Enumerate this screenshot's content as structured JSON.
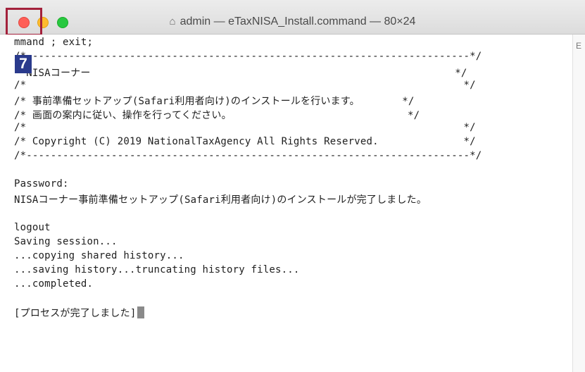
{
  "window": {
    "title": "admin — eTaxNISA_Install.command — 80×24",
    "home_icon": "⌂"
  },
  "step_badge": "7",
  "terminal": {
    "lines": [
      "mmand ; exit;",
      "/*-------------------------------------------------------------------------*/",
      "  NISAコーナー                                                            */",
      "/*                                                                        */",
      "/* 事前準備セットアップ(Safari利用者向け)のインストールを行います。       */",
      "/* 画面の案内に従い、操作を行ってください。                             */",
      "/*                                                                        */",
      "/* Copyright (C) 2019 NationalTaxAgency All Rights Reserved.              */",
      "/*-------------------------------------------------------------------------*/",
      "",
      "Password:",
      "NISAコーナー事前準備セットアップ(Safari利用者向け)のインストールが完了しました。",
      "",
      "logout",
      "Saving session...",
      "...copying shared history...",
      "...saving history...truncating history files...",
      "...completed.",
      "",
      "[プロセスが完了しました]"
    ]
  },
  "scroll_marker": "E"
}
